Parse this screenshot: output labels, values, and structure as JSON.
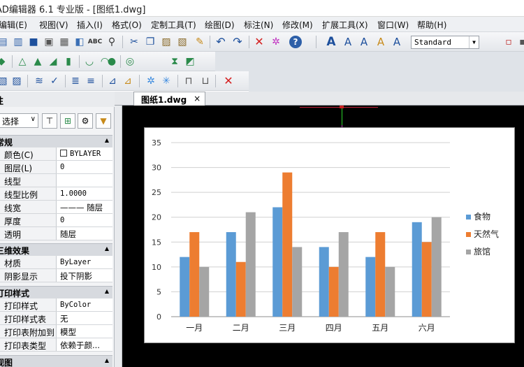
{
  "window": {
    "title": "AD编辑器 6.1 专业版  - [图纸1.dwg]"
  },
  "menu": {
    "items": [
      "编辑(E)",
      "视图(V)",
      "插入(I)",
      "格式(O)",
      "定制工具(T)",
      "绘图(D)",
      "标注(N)",
      "修改(M)",
      "扩展工具(X)",
      "窗口(W)",
      "帮助(H)"
    ]
  },
  "toolbar": {
    "text_style": "Standard",
    "icons": [
      "cut-icon",
      "copy-icon",
      "paste-icon",
      "undo-icon",
      "redo-icon",
      "delete-icon",
      "help-icon",
      "text-icon"
    ]
  },
  "properties_panel": {
    "title": "性",
    "selector": "选择",
    "sections": [
      {
        "name": "常规",
        "rows": [
          {
            "key": "颜色(C)",
            "value": "BYLAYER"
          },
          {
            "key": "图层(L)",
            "value": "0"
          },
          {
            "key": "线型",
            "value": ""
          },
          {
            "key": "线型比例",
            "value": "1.0000"
          },
          {
            "key": "线宽",
            "value": "——— 随层"
          },
          {
            "key": "厚度",
            "value": "0"
          },
          {
            "key": "透明",
            "value": "随层"
          }
        ]
      },
      {
        "name": "三维效果",
        "rows": [
          {
            "key": "材质",
            "value": "ByLayer"
          },
          {
            "key": "阴影显示",
            "value": "投下阴影"
          }
        ]
      },
      {
        "name": "打印样式",
        "rows": [
          {
            "key": "打印样式",
            "value": "ByColor"
          },
          {
            "key": "打印样式表",
            "value": "无"
          },
          {
            "key": "打印表附加到",
            "value": "模型"
          },
          {
            "key": "打印表类型",
            "value": "依赖于颜..."
          }
        ]
      },
      {
        "name": "视图",
        "rows": []
      }
    ]
  },
  "tabs": [
    {
      "label": "图纸1.dwg",
      "close": "×"
    }
  ],
  "chart_data": {
    "type": "bar",
    "categories": [
      "一月",
      "二月",
      "三月",
      "四月",
      "五月",
      "六月"
    ],
    "series": [
      {
        "name": "食物",
        "color": "#5b9bd5",
        "values": [
          12,
          17,
          22,
          14,
          12,
          19
        ]
      },
      {
        "name": "天然气",
        "color": "#ed7d31",
        "values": [
          17,
          11,
          29,
          10,
          17,
          15
        ]
      },
      {
        "name": "旅馆",
        "color": "#a5a5a5",
        "values": [
          10,
          21,
          14,
          17,
          10,
          20
        ]
      }
    ],
    "ylim": [
      0,
      35
    ],
    "yticks": [
      0,
      5,
      10,
      15,
      20,
      25,
      30,
      35
    ],
    "grid": true,
    "legend": "right"
  }
}
